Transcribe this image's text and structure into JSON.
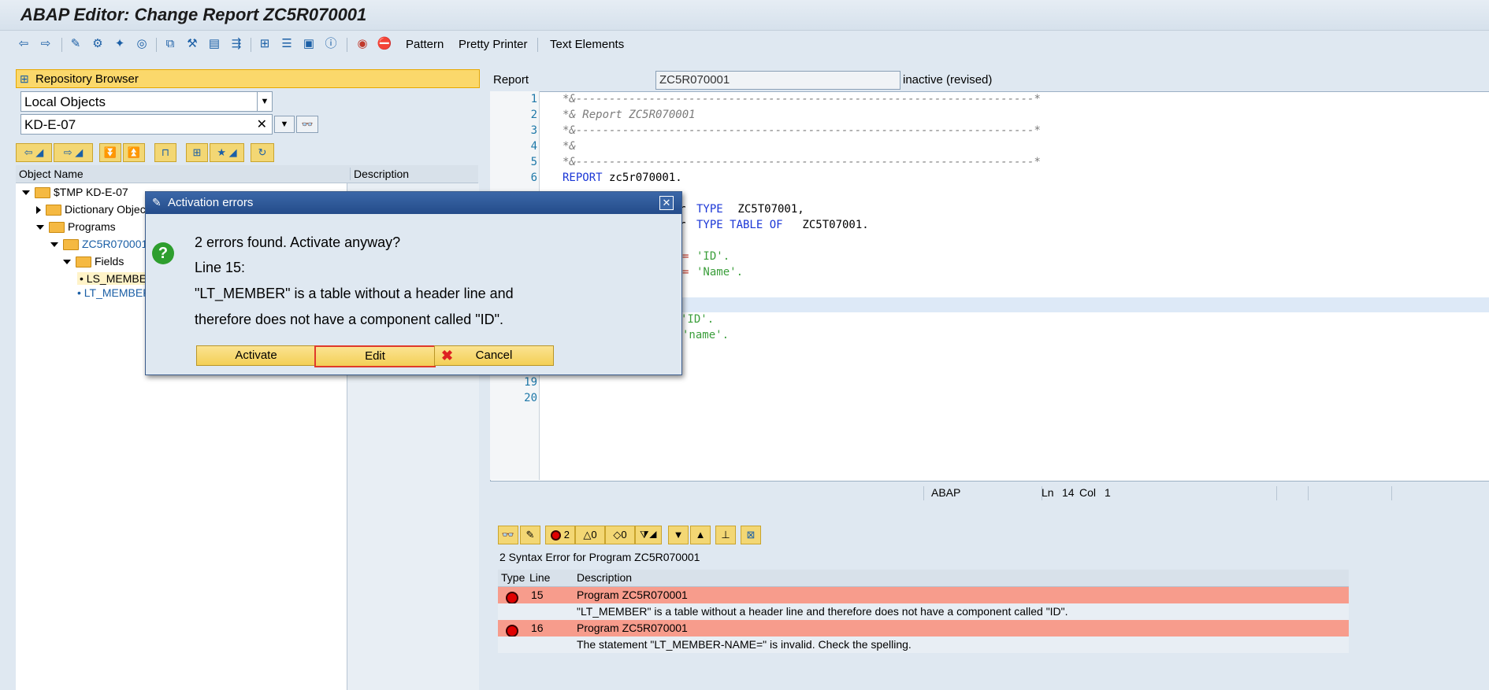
{
  "window": {
    "title": "ABAP Editor: Change Report ZC5R070001"
  },
  "toolbar": {
    "pattern": "Pattern",
    "pretty_printer": "Pretty Printer",
    "text_elements": "Text Elements"
  },
  "repository": {
    "header": "Repository Browser",
    "object_type": "Local Objects",
    "package": "KD-E-07",
    "clear_symbol": "✕",
    "col_object_name": "Object Name",
    "col_description": "Description",
    "tree": [
      "$TMP KD-E-07",
      "Dictionary Objects",
      "Programs",
      "ZC5R070001",
      "Fields",
      "LS_MEMBER",
      "LT_MEMBER"
    ]
  },
  "editor": {
    "report_label": "Report",
    "report_name": "ZC5R070001",
    "status": "inactive (revised)",
    "lines": [
      {
        "n": "1",
        "t": "*&---------------------------------------------------------------------*"
      },
      {
        "n": "2",
        "t": "*& Report ZC5R070001"
      },
      {
        "n": "3",
        "t": "*&---------------------------------------------------------------------*"
      },
      {
        "n": "4",
        "t": "*&"
      },
      {
        "n": "5",
        "t": "*&---------------------------------------------------------------------*"
      },
      {
        "n": "6",
        "t": "REPORT zc5r070001."
      }
    ],
    "frag_type": "TYPE",
    "frag_struct": " ZC5T07001,",
    "frag_type_table_of": "TYPE TABLE OF",
    "frag_table": " ZC5T07001.",
    "frag_r": "r",
    "frag_eq": "=",
    "frag_id": "'ID'.",
    "frag_name": "'Name'.",
    "frag_id2": "'ID'.",
    "frag_name2": "'name'.",
    "line19": "19",
    "line20": "20",
    "status_lang": "ABAP",
    "status_pos_ln": "Ln",
    "status_ln": "14",
    "status_col_lbl": "Col",
    "status_col": "1"
  },
  "errors": {
    "count_errors": "2",
    "count_warnings": "0",
    "count_info": "0",
    "title": "2 Syntax Error for Program ZC5R070001",
    "col_type": "Type",
    "col_line": "Line",
    "col_description": "Description",
    "rows": [
      {
        "line": "15",
        "program": "Program ZC5R070001",
        "message": "\"LT_MEMBER\" is a table without a header line and therefore does not have a component called \"ID\"."
      },
      {
        "line": "16",
        "program": "Program ZC5R070001",
        "message": "The statement \"LT_MEMBER-NAME=\" is invalid. Check the spelling."
      }
    ]
  },
  "dialog": {
    "title": "Activation errors",
    "question": "2 errors found. Activate anyway?",
    "line_info": "Line 15:",
    "message_1": "\"LT_MEMBER\" is a table without a header line and",
    "message_2": "therefore does not have a component called \"ID\".",
    "btn_activate": "Activate",
    "btn_edit": "Edit",
    "btn_cancel": "Cancel"
  }
}
